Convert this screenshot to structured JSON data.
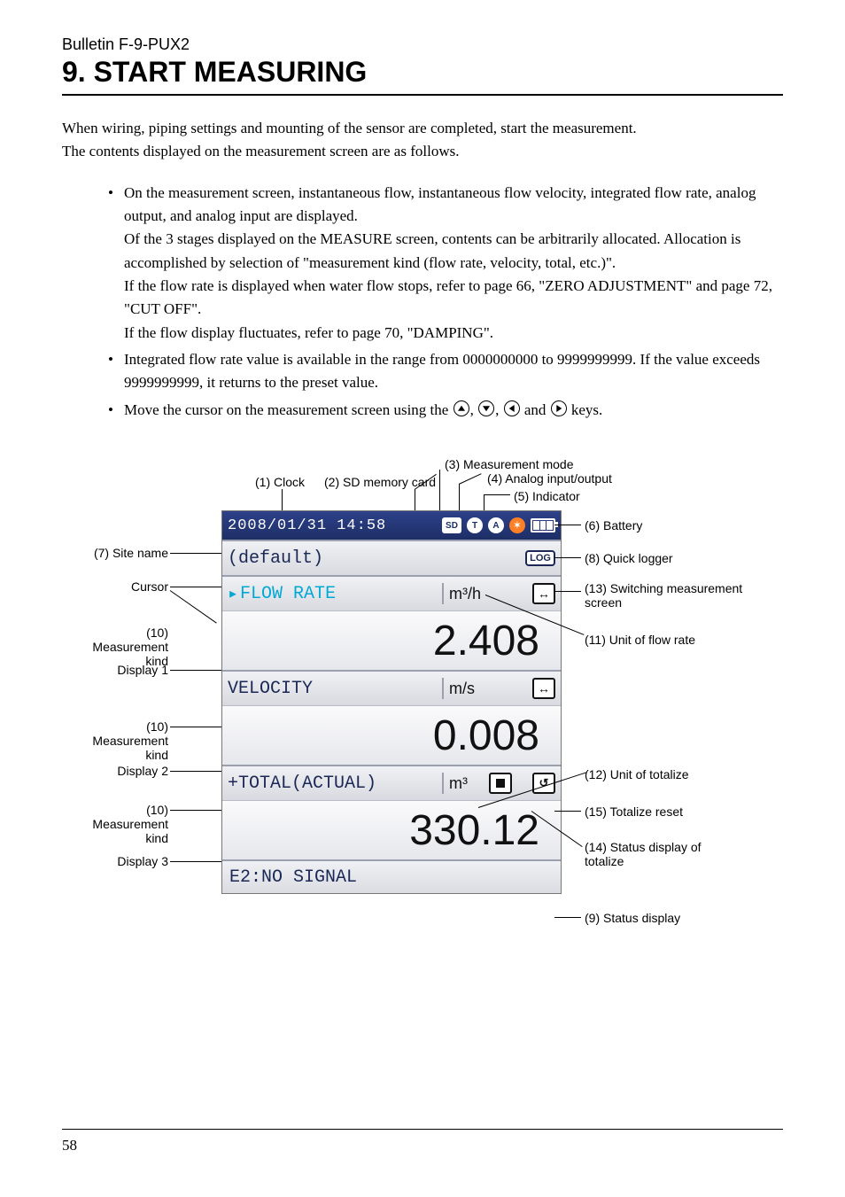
{
  "header": {
    "bulletin": "Bulletin F-9-PUX2",
    "section_title": "9.  START MEASURING"
  },
  "intro": {
    "p1": "When wiring, piping settings and mounting of the sensor are completed, start the measurement.",
    "p2": "The contents displayed on the measurement screen are as follows."
  },
  "bullets": {
    "b1a": "On the measurement screen, instantaneous flow, instantaneous flow velocity, integrated flow rate, analog output, and analog input are displayed.",
    "b1b": "Of the 3 stages displayed on the MEASURE screen, contents can be arbitrarily allocated.  Allocation is accomplished by selection of \"measurement kind (flow rate, velocity, total, etc.)\".",
    "b1c": "If the flow rate is displayed when water flow stops, refer to page 66, \"ZERO ADJUSTMENT\" and page 72, \"CUT OFF\".",
    "b1d": "If the flow display fluctuates, refer to page 70, \"DAMPING\".",
    "b2": "Integrated flow rate value is available in the range from 0000000000 to 9999999999.  If the value exceeds 9999999999, it returns to the preset value.",
    "b3a": "Move the cursor on the measurement screen using the ",
    "b3b": " keys."
  },
  "callouts": {
    "c1": "(1) Clock",
    "c2": "(2) SD memory card",
    "c3": "(3) Measurement mode",
    "c4": "(4) Analog input/output",
    "c5": "(5) Indicator",
    "c6": "(6) Battery",
    "c7": "(7) Site name",
    "c8": "(8) Quick logger",
    "c9": "(9) Status display",
    "c10": "(10)  Measurement kind",
    "c11": "(11)  Unit of flow rate",
    "c12": "(12)  Unit of totalize",
    "c13": "(13)  Switching measurement screen",
    "c14": "(14)  Status display of totalize",
    "c15": "(15)  Totalize reset",
    "cursor": "Cursor",
    "d1": "Display 1",
    "d2": "Display 2",
    "d3": "Display 3"
  },
  "device": {
    "clock": "2008/01/31 14:58",
    "icons": {
      "sd": "SD",
      "mode": "T",
      "aio": "A",
      "log": "LOG"
    },
    "site": "(default)",
    "row1": {
      "kind": "FLOW RATE",
      "unit": "m³/h",
      "value": "2.408"
    },
    "row2": {
      "kind": "VELOCITY",
      "unit": "m/s",
      "value": "0.008"
    },
    "row3": {
      "kind": "+TOTAL(ACTUAL)",
      "unit": "m³",
      "value": "330.12"
    },
    "status": "E2:NO SIGNAL"
  },
  "b3_joins": {
    "comma": ", ",
    "and": " and "
  },
  "page_number": "58"
}
